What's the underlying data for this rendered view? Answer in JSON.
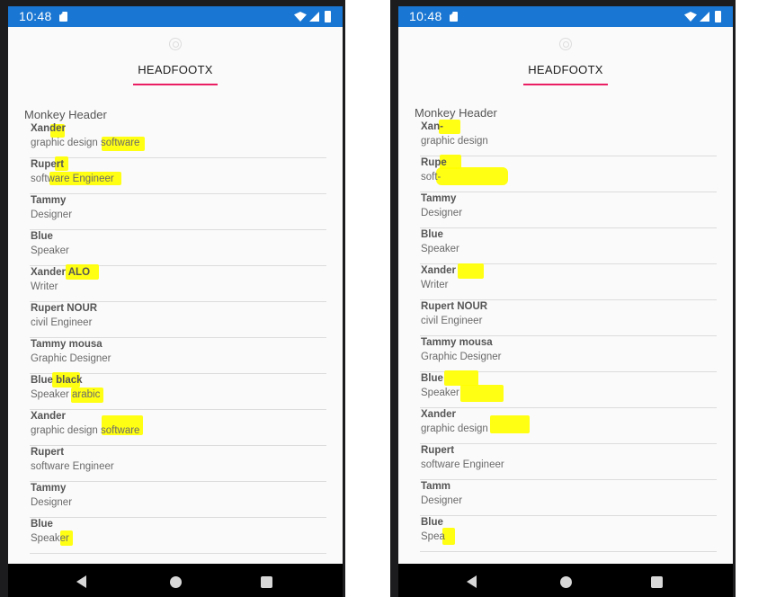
{
  "phones": [
    {
      "status": {
        "time": "10:48"
      },
      "title": "HEADFOOTX",
      "list_header": "Monkey Header",
      "items": [
        {
          "name": "Xander",
          "role": "graphic design software"
        },
        {
          "name": "Rupert",
          "role": "software Engineer"
        },
        {
          "name": "Tammy",
          "role": "Designer"
        },
        {
          "name": "Blue",
          "role": "Speaker"
        },
        {
          "name": "Xander ALO",
          "role": "Writer"
        },
        {
          "name": "Rupert NOUR",
          "role": "civil Engineer"
        },
        {
          "name": "Tammy mousa",
          "role": "Graphic Designer"
        },
        {
          "name": "Blue black",
          "role": "Speaker arabic"
        },
        {
          "name": "Xander",
          "role": "graphic design software"
        },
        {
          "name": "Rupert",
          "role": "software Engineer"
        },
        {
          "name": "Tammy",
          "role": "Designer"
        },
        {
          "name": "Blue",
          "role": "Speaker"
        }
      ]
    },
    {
      "status": {
        "time": "10:48"
      },
      "title": "HEADFOOTX",
      "list_header": "Monkey Header",
      "items": [
        {
          "name": "Xan-",
          "role": "graphic design"
        },
        {
          "name": "Rupe",
          "role": "soft-"
        },
        {
          "name": "Tammy",
          "role": "Designer"
        },
        {
          "name": "Blue",
          "role": "Speaker"
        },
        {
          "name": "Xander",
          "role": "Writer"
        },
        {
          "name": "Rupert NOUR",
          "role": "civil Engineer"
        },
        {
          "name": "Tammy mousa",
          "role": "Graphic Designer"
        },
        {
          "name": "Blue",
          "role": "Speaker"
        },
        {
          "name": "Xander",
          "role": "graphic design"
        },
        {
          "name": "Rupert",
          "role": "software Engineer"
        },
        {
          "name": "Tamm",
          "role": "Designer"
        },
        {
          "name": "Blue",
          "role": "Spea"
        }
      ]
    }
  ],
  "colors": {
    "status_bar": "#1976d2",
    "tab_indicator": "#e91e63",
    "highlight": "#ffff00",
    "nav_bar": "#000000"
  }
}
